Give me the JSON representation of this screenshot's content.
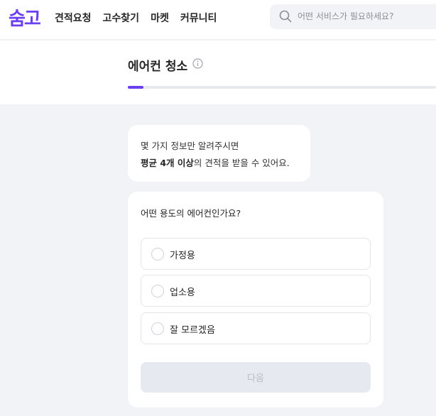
{
  "header": {
    "logo_text": "숨고",
    "brand_color": "#6a3ff0",
    "nav": [
      "견적요청",
      "고수찾기",
      "마켓",
      "커뮤니티"
    ],
    "search": {
      "placeholder": "어떤 서비스가 필요하세요?",
      "icon": "search-icon"
    }
  },
  "page": {
    "title": "에어컨 청소",
    "info_icon": "info-icon",
    "progress_fraction": 0.05
  },
  "intro": {
    "line1": "몇 가지 정보만 알려주시면",
    "line2_bold": "평균 4개 이상",
    "line2_rest": "의 견적을 받을 수 있어요."
  },
  "form": {
    "question": "어떤 용도의 에어컨인가요?",
    "options": [
      "가정용",
      "업소용",
      "잘 모르겠음"
    ],
    "next_label": "다음"
  }
}
